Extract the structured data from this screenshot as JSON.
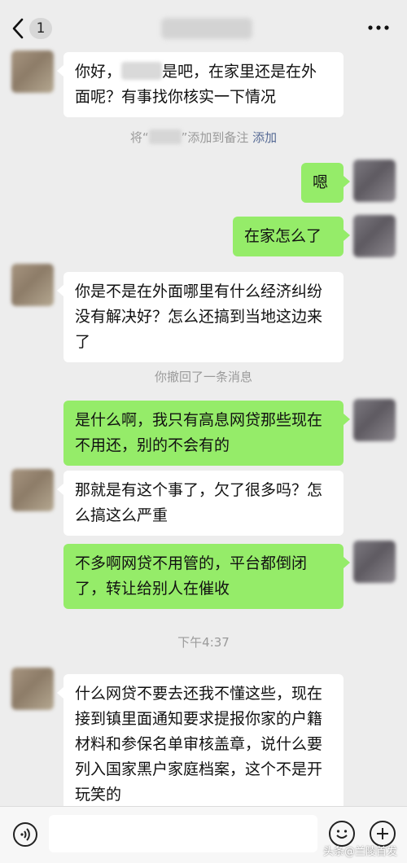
{
  "header": {
    "back_label": "<",
    "unread_count": "1",
    "more_icon": "more-dots-icon"
  },
  "messages": [
    {
      "side": "other",
      "text_before": "你好，",
      "text_after": "是吧，在家里还是在外面呢？有事找你核实一下情况"
    },
    {
      "side": "system",
      "text_prefix": "将“",
      "text_suffix": "”添加到备注",
      "link": "添加"
    },
    {
      "side": "me",
      "text": "嗯"
    },
    {
      "side": "me",
      "text": "在家怎么了"
    },
    {
      "side": "other",
      "text": "你是不是在外面哪里有什么经济纠纷没有解决好？怎么还搞到当地这边来了"
    },
    {
      "side": "system",
      "text": "你撤回了一条消息"
    },
    {
      "side": "me",
      "text": "是什么啊，我只有高息网贷那些现在不用还，别的不会有的"
    },
    {
      "side": "other",
      "text": "那就是有这个事了，欠了很多吗？怎么搞这么严重"
    },
    {
      "side": "me",
      "text": "不多啊网贷不用管的，平台都倒闭了，转让给别人在催收"
    },
    {
      "side": "system",
      "text": "下午4:37"
    },
    {
      "side": "other",
      "text": "什么网贷不要去还我不懂这些，现在接到镇里面通知要求提报你家的户籍材料和参保名单审核盖章，说什么要列入国家黑户家庭档案，这个不是开玩笑的"
    }
  ],
  "bottom": {
    "voice_icon": "voice-icon",
    "emoji_icon": "emoji-icon",
    "plus_icon": "plus-icon",
    "input_value": ""
  },
  "watermark": "头条@兰陵首发",
  "colors": {
    "background": "#ededed",
    "my_bubble": "#95ec69",
    "other_bubble": "#ffffff",
    "link": "#576b95"
  }
}
